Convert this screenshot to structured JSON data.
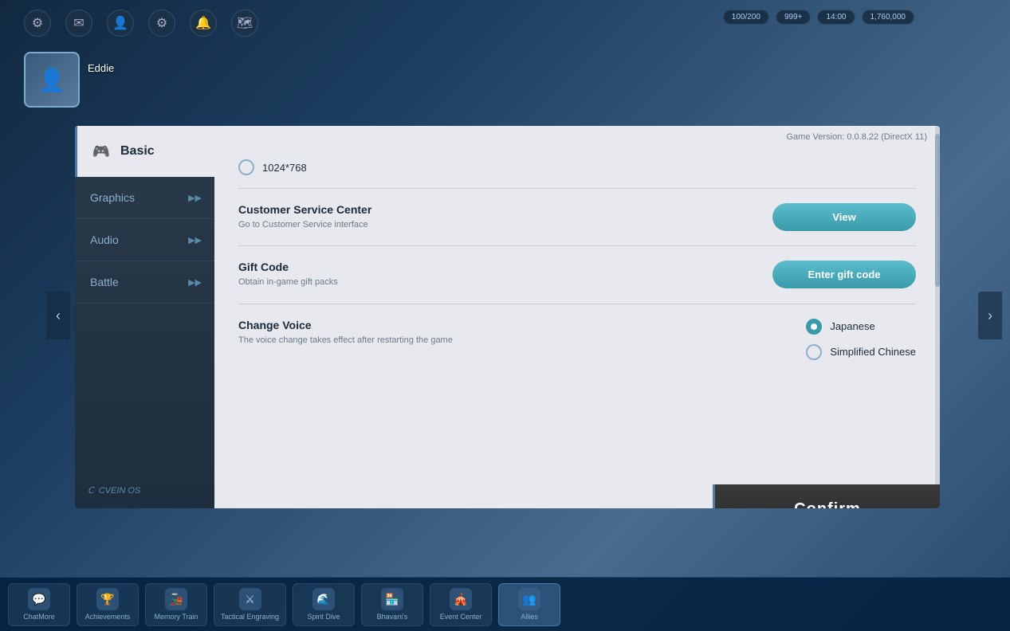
{
  "background": {
    "color1": "#1a3a5c",
    "color2": "#4a7aac"
  },
  "top_toolbar": {
    "icons": [
      "⚙",
      "✉",
      "👤",
      "⚙",
      "🔔",
      "🗺"
    ]
  },
  "username": "Eddie",
  "top_right_hud": {
    "items": [
      "100/200",
      "999+",
      "14:00",
      "1,760,000"
    ]
  },
  "modal": {
    "game_version": "Game Version: 0.0.8.22 (DirectX 11)",
    "close_label": "✕",
    "sidebar": {
      "items": [
        {
          "id": "basic",
          "label": "Basic",
          "active": true,
          "icon": "🎮"
        },
        {
          "id": "graphics",
          "label": "Graphics",
          "active": false,
          "icon": ""
        },
        {
          "id": "audio",
          "label": "Audio",
          "active": false,
          "icon": ""
        },
        {
          "id": "battle",
          "label": "Battle",
          "active": false,
          "icon": ""
        }
      ],
      "logo": "CVEIN OS"
    },
    "content": {
      "resolution": {
        "label": "1024*768",
        "selected": false
      },
      "customer_service": {
        "title": "Customer Service Center",
        "desc": "Go to Customer Service interface",
        "button_label": "View"
      },
      "gift_code": {
        "title": "Gift Code",
        "desc": "Obtain in-game gift packs",
        "button_label": "Enter gift code"
      },
      "change_voice": {
        "title": "Change Voice",
        "desc": "The voice change takes effect after restarting the game",
        "options": [
          {
            "id": "japanese",
            "label": "Japanese",
            "selected": true
          },
          {
            "id": "simplified_chinese",
            "label": "Simplified Chinese",
            "selected": false
          }
        ]
      }
    },
    "confirm_label": "Confirm"
  },
  "taskbar": {
    "items": [
      {
        "label": "ChatMore",
        "active": false
      },
      {
        "label": "Achievements",
        "active": false
      },
      {
        "label": "Memory Train",
        "active": false
      },
      {
        "label": "Tactical Engraving",
        "active": false
      },
      {
        "label": "Spirit Dive",
        "active": false
      },
      {
        "label": "Bhavani's",
        "active": false
      },
      {
        "label": "Event Center",
        "active": false
      },
      {
        "label": "Allies",
        "active": true
      }
    ]
  }
}
